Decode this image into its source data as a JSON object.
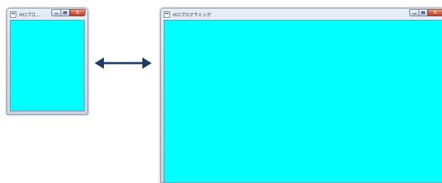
{
  "small_window": {
    "title": "HCIプロ...",
    "client_color": "#00ffff"
  },
  "large_window": {
    "title": "HCIプログラミング",
    "client_color": "#00ffff"
  },
  "arrow": {
    "color": "#1f3b63",
    "direction": "bidirectional"
  },
  "icons": {
    "app": "app-icon",
    "minimize": "minimize-icon",
    "maximize": "maximize-icon",
    "close": "close-icon",
    "arrow": "double-arrow-icon"
  }
}
